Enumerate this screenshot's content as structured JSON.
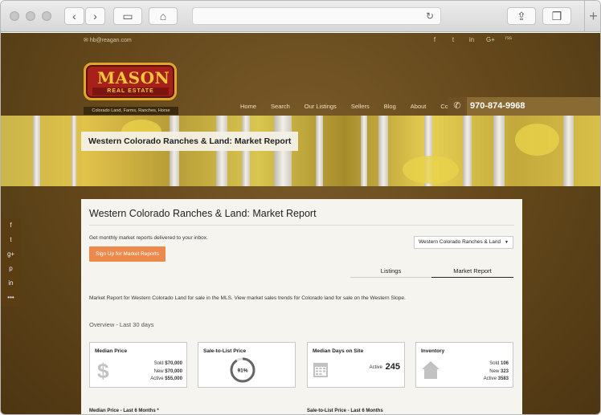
{
  "browser": {
    "back": "‹",
    "forward": "›",
    "sidebar": "▭",
    "home": "⌂",
    "reload": "↻",
    "share": "⇪",
    "tabs": "❐",
    "new_tab": "+"
  },
  "topbar": {
    "email": "hb@reagan.com",
    "social": [
      "f",
      "t",
      "in",
      "G+",
      "rss"
    ]
  },
  "logo": {
    "main": "MASON",
    "sub": "REAL ESTATE",
    "tagline": "Colorado Land, Farms, Ranches, Horse Property"
  },
  "nav": {
    "items": [
      "Home",
      "Search",
      "Our Listings",
      "Sellers",
      "Blog",
      "About",
      "Contact"
    ]
  },
  "phone": {
    "icon": "phone-icon",
    "number": "970-874-9968"
  },
  "banner": {
    "title": "Western Colorado Ranches & Land: Market Report"
  },
  "side_social": [
    "f",
    "t",
    "g+",
    "p",
    "in",
    "•••"
  ],
  "report": {
    "title": "Western Colorado Ranches & Land: Market Report",
    "intro": "Get monthly market reports delivered to your inbox.",
    "signup": "Sign Up for Market Reports",
    "select": "Western Colorado Ranches & Land",
    "tabs": [
      "Listings",
      "Market Report"
    ],
    "description": "Market Report for Western Colorado Land for sale in the MLS. View market sales trends for Colorado land for sale on the Western Slope.",
    "overview": "Overview - Last 30 days",
    "stats": {
      "median_price": {
        "title": "Median Price",
        "icon": "dollar-icon",
        "sold_label": "Sold",
        "sold": "$70,000",
        "new_label": "New",
        "new": "$70,000",
        "active_label": "Active",
        "active": "$55,000"
      },
      "sale_to_list": {
        "title": "Sale-to-List Price",
        "value": "91%",
        "fraction": 0.91
      },
      "median_days": {
        "title": "Median Days on Site",
        "icon": "calendar-icon",
        "active_label": "Active",
        "active": "245"
      },
      "inventory": {
        "title": "Inventory",
        "icon": "house-icon",
        "sold_label": "Sold",
        "sold": "106",
        "new_label": "New",
        "new": "323",
        "active_label": "Active",
        "active": "3583"
      }
    },
    "sections": [
      "Median Price - Last 6 Months *",
      "Sale-to-List Price - Last 6 Months"
    ]
  }
}
